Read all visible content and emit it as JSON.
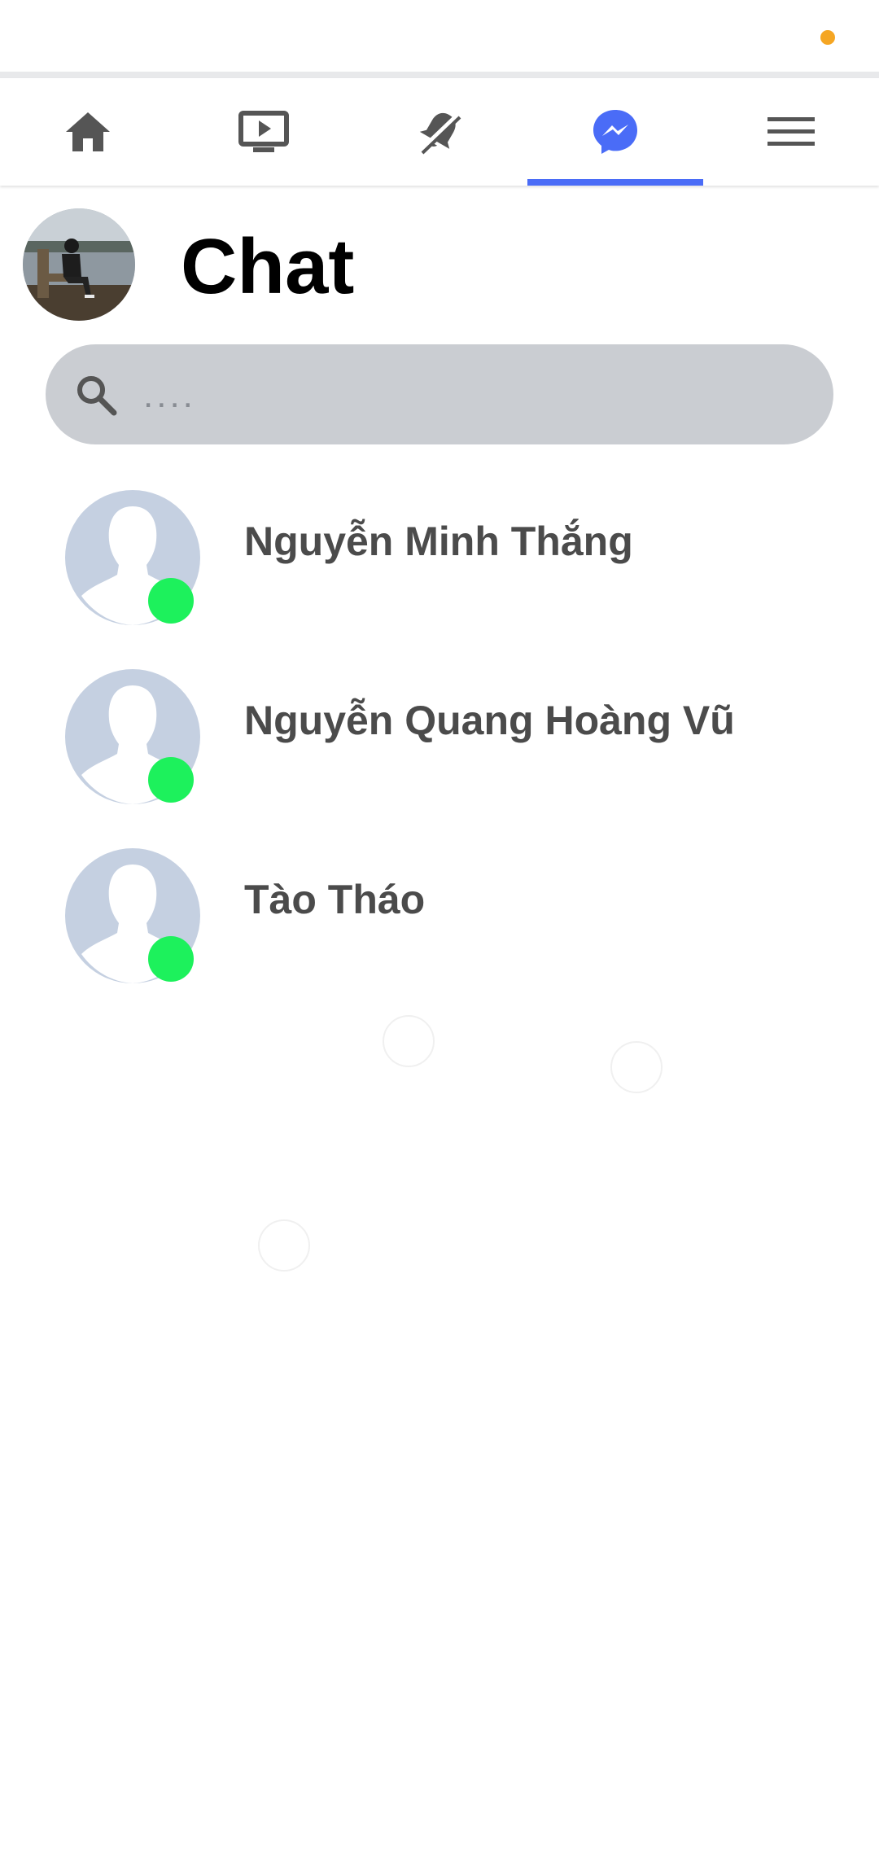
{
  "status_bar": {
    "indicator_color": "#f5a623"
  },
  "nav": {
    "tabs": [
      {
        "name": "home",
        "icon": "home-icon"
      },
      {
        "name": "watch",
        "icon": "video-icon"
      },
      {
        "name": "notifications",
        "icon": "bell-off-icon"
      },
      {
        "name": "chat",
        "icon": "messenger-icon",
        "active": true
      },
      {
        "name": "menu",
        "icon": "menu-icon"
      }
    ],
    "active_color": "#4a6cf7"
  },
  "header": {
    "title": "Chat"
  },
  "search": {
    "placeholder": "....",
    "value": ""
  },
  "contacts": [
    {
      "name": "Nguyễn Minh Thắng",
      "online": true
    },
    {
      "name": "Nguyễn Quang Hoàng Vũ",
      "online": true
    },
    {
      "name": "Tào Tháo",
      "online": true
    }
  ],
  "colors": {
    "online": "#1df15c",
    "search_bg": "#cacdd2",
    "name_text": "#4b4b4b"
  }
}
